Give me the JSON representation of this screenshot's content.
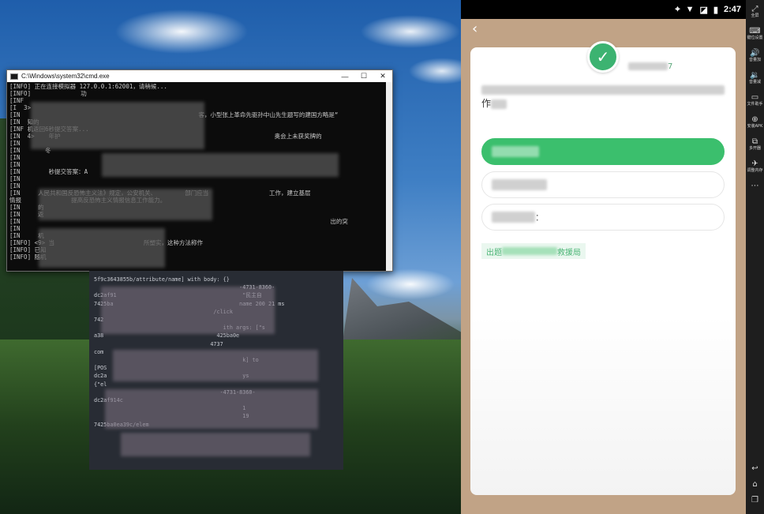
{
  "desktop": {
    "wallpaper": "mountain-lake-wallpaper"
  },
  "cmd_window": {
    "title": "C:\\Windows\\system32\\cmd.exe",
    "lines": [
      "[INFO] 正在连接模拟器 127.0.0.1:62001，请稍候...",
      "[INFO]              功",
      "[INF",
      "[I  3>          ",
      "[IN                                                  客，小型张上革命先驱孙中山先生题写的建国方略是“",
      "[IN  知的",
      "[INF 机返回6秒提交答案...",
      "[IN  4>    年护                                                            奥会上未获奖牌的",
      "[IN",
      "[IN       冬",
      "[IN",
      "[IN",
      "[IN        秒提交答案：A",
      "[IN",
      "[IN",
      "[IN     人民共和国反恐怖主义法》规定，公安机关、        部门应当                 工作，建立基层",
      "情报              提高反恐怖主义情报信息工作能力。",
      "[IN     的",
      "[IN     返",
      "[IN                                                                                       出的突",
      "[IN",
      "[IN     机",
      "[INFO] <9> 当                         所塑实，这种方法称作",
      "[INFO] 已知",
      "[INFO] 随机"
    ]
  },
  "terminal": {
    "lines": [
      "5f9c3643855b/attribute/name] with body: {}",
      "                                             -4731-8360-",
      "dc2af91                                       \"民主自",
      "",
      "7425ba                                       name 200 21 ms",
      "",
      "",
      "                                     /click",
      "742",
      "                                        ith args: [\"s",
      "a38                                   425ba0e",
      "                                    4737",
      "com",
      "                                              k] to",
      "[POS",
      "dc2a                                          ys",
      "{\"el",
      "                                       -4731-8360-",
      "dc2af914c",
      "                                              1",
      "                                              19",
      "7425ba0ea39c/elem"
    ]
  },
  "emulator": {
    "status": {
      "time": "2:47",
      "icons": [
        "location-icon",
        "wifi-icon",
        "no-sim-icon",
        "battery-icon"
      ]
    },
    "card": {
      "check_label": "7",
      "question_tail": "作",
      "options": [
        {
          "label": "",
          "selected": true
        },
        {
          "label": "",
          "selected": false
        },
        {
          "label": "：",
          "selected": false
        }
      ],
      "source_prefix": "出题",
      "source_suffix": "救援局"
    }
  },
  "toolbar": {
    "items": [
      {
        "icon": "⤢",
        "label": "全屏"
      },
      {
        "icon": "⌨",
        "label": "键位设置"
      },
      {
        "icon": "🔊",
        "label": "音量加"
      },
      {
        "icon": "🔉",
        "label": "音量减"
      },
      {
        "icon": "▭",
        "label": "文件助手"
      },
      {
        "icon": "⊕",
        "label": "安装APK"
      },
      {
        "icon": "⧉",
        "label": "多开器"
      },
      {
        "icon": "✈",
        "label": "调整内存"
      },
      {
        "icon": "⋯",
        "label": ""
      }
    ],
    "nav": [
      {
        "icon": "↩"
      },
      {
        "icon": "⌂"
      },
      {
        "icon": "❐"
      }
    ]
  }
}
